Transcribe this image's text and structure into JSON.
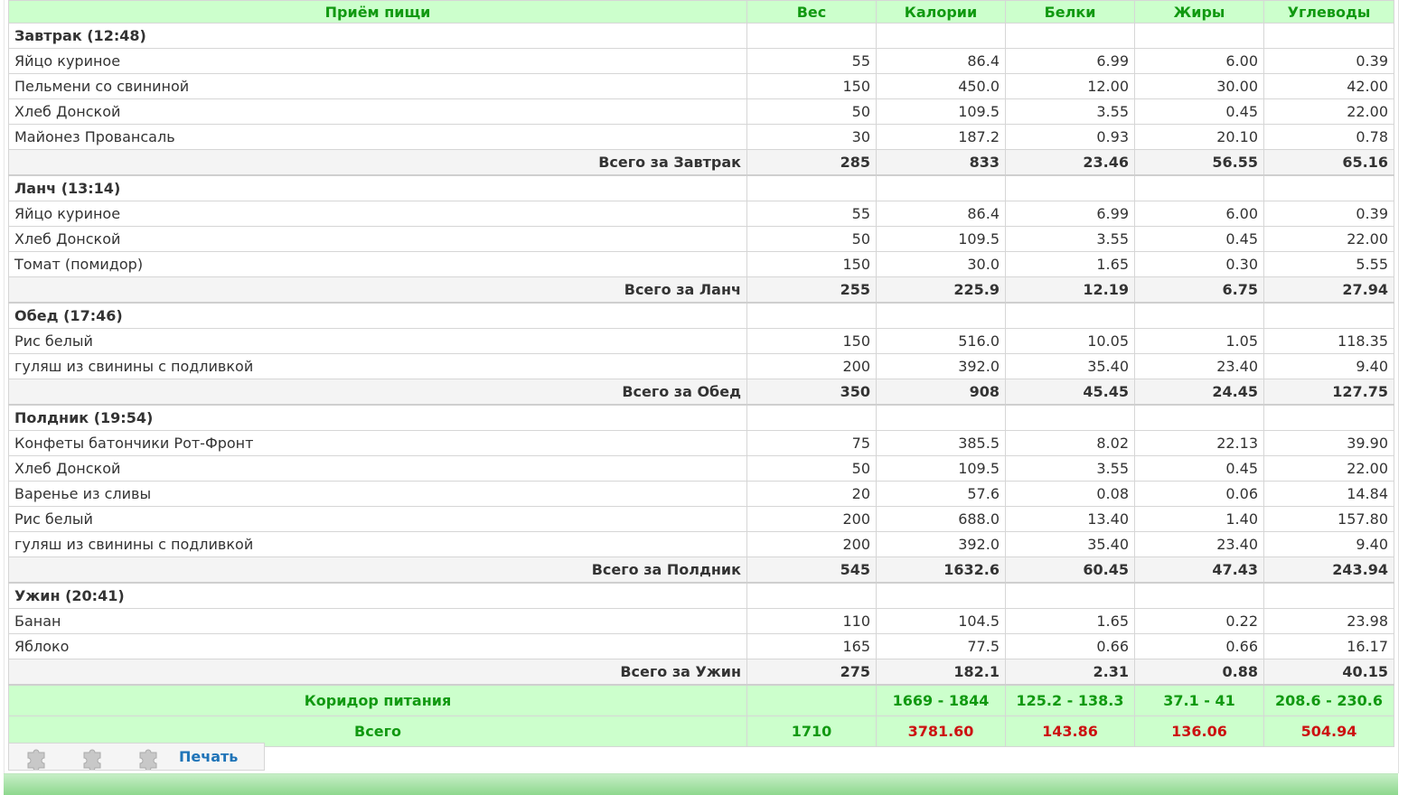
{
  "headers": {
    "meal": "Приём пищи",
    "weight": "Вес",
    "calories": "Калории",
    "protein": "Белки",
    "fat": "Жиры",
    "carbs": "Углеводы"
  },
  "meals": [
    {
      "title": "Завтрак (12:48)",
      "items": [
        {
          "name": "Яйцо куриное",
          "weight": "55",
          "calories": "86.4",
          "protein": "6.99",
          "fat": "6.00",
          "carbs": "0.39"
        },
        {
          "name": "Пельмени со свининой",
          "weight": "150",
          "calories": "450.0",
          "protein": "12.00",
          "fat": "30.00",
          "carbs": "42.00"
        },
        {
          "name": "Хлеб Донской",
          "weight": "50",
          "calories": "109.5",
          "protein": "3.55",
          "fat": "0.45",
          "carbs": "22.00"
        },
        {
          "name": "Майонез Провансаль",
          "weight": "30",
          "calories": "187.2",
          "protein": "0.93",
          "fat": "20.10",
          "carbs": "0.78"
        }
      ],
      "total": {
        "label": "Всего за Завтрак",
        "weight": "285",
        "calories": "833",
        "protein": "23.46",
        "fat": "56.55",
        "carbs": "65.16"
      }
    },
    {
      "title": "Ланч (13:14)",
      "items": [
        {
          "name": "Яйцо куриное",
          "weight": "55",
          "calories": "86.4",
          "protein": "6.99",
          "fat": "6.00",
          "carbs": "0.39"
        },
        {
          "name": "Хлеб Донской",
          "weight": "50",
          "calories": "109.5",
          "protein": "3.55",
          "fat": "0.45",
          "carbs": "22.00"
        },
        {
          "name": "Томат (помидор)",
          "weight": "150",
          "calories": "30.0",
          "protein": "1.65",
          "fat": "0.30",
          "carbs": "5.55"
        }
      ],
      "total": {
        "label": "Всего за Ланч",
        "weight": "255",
        "calories": "225.9",
        "protein": "12.19",
        "fat": "6.75",
        "carbs": "27.94"
      }
    },
    {
      "title": "Обед (17:46)",
      "items": [
        {
          "name": "Рис белый",
          "weight": "150",
          "calories": "516.0",
          "protein": "10.05",
          "fat": "1.05",
          "carbs": "118.35"
        },
        {
          "name": "гуляш из свинины с подливкой",
          "weight": "200",
          "calories": "392.0",
          "protein": "35.40",
          "fat": "23.40",
          "carbs": "9.40"
        }
      ],
      "total": {
        "label": "Всего за Обед",
        "weight": "350",
        "calories": "908",
        "protein": "45.45",
        "fat": "24.45",
        "carbs": "127.75"
      }
    },
    {
      "title": "Полдник (19:54)",
      "items": [
        {
          "name": "Конфеты батончики Рот-Фронт",
          "weight": "75",
          "calories": "385.5",
          "protein": "8.02",
          "fat": "22.13",
          "carbs": "39.90"
        },
        {
          "name": "Хлеб Донской",
          "weight": "50",
          "calories": "109.5",
          "protein": "3.55",
          "fat": "0.45",
          "carbs": "22.00"
        },
        {
          "name": "Варенье из сливы",
          "weight": "20",
          "calories": "57.6",
          "protein": "0.08",
          "fat": "0.06",
          "carbs": "14.84"
        },
        {
          "name": "Рис белый",
          "weight": "200",
          "calories": "688.0",
          "protein": "13.40",
          "fat": "1.40",
          "carbs": "157.80"
        },
        {
          "name": "гуляш из свинины с подливкой",
          "weight": "200",
          "calories": "392.0",
          "protein": "35.40",
          "fat": "23.40",
          "carbs": "9.40"
        }
      ],
      "total": {
        "label": "Всего за Полдник",
        "weight": "545",
        "calories": "1632.6",
        "protein": "60.45",
        "fat": "47.43",
        "carbs": "243.94"
      }
    },
    {
      "title": "Ужин (20:41)",
      "items": [
        {
          "name": "Банан",
          "weight": "110",
          "calories": "104.5",
          "protein": "1.65",
          "fat": "0.22",
          "carbs": "23.98"
        },
        {
          "name": "Яблоко",
          "weight": "165",
          "calories": "77.5",
          "protein": "0.66",
          "fat": "0.66",
          "carbs": "16.17"
        }
      ],
      "total": {
        "label": "Всего за Ужин",
        "weight": "275",
        "calories": "182.1",
        "protein": "2.31",
        "fat": "0.88",
        "carbs": "40.15"
      }
    }
  ],
  "corridor": {
    "label": "Коридор питания",
    "weight": "",
    "calories": "1669 - 1844",
    "protein": "125.2 - 138.3",
    "fat": "37.1 - 41",
    "carbs": "208.6 - 230.6"
  },
  "grand_total": {
    "label": "Всего",
    "weight": "1710",
    "calories": "3781.60",
    "protein": "143.86",
    "fat": "136.06",
    "carbs": "504.94"
  },
  "toolbar": {
    "icons": [
      "puzzle-icon",
      "puzzle-icon",
      "puzzle-icon"
    ],
    "print_label": "Печать"
  },
  "colors": {
    "header_bg": "#ccffcc",
    "header_text": "#119911",
    "over_limit": "#cc1111",
    "link": "#1f74b8"
  }
}
